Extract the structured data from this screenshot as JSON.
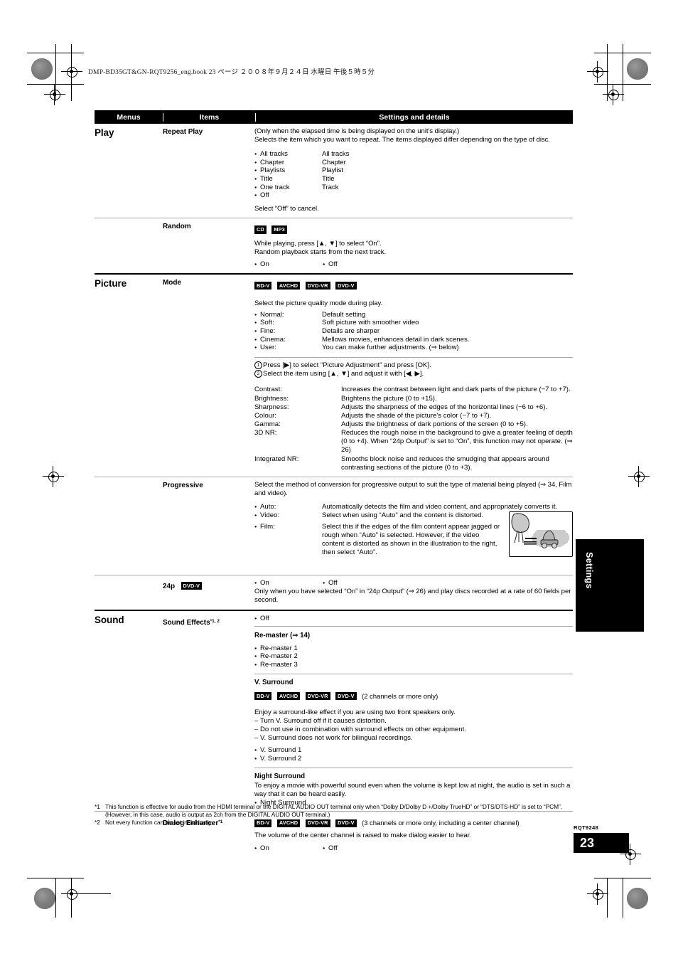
{
  "page": {
    "header_line": "DMP-BD35GT&GN-RQT9256_eng.book   23 ページ   ２００８年９月２４日   水曜日   午後５時５分",
    "side_tab": "Settings",
    "doc_code": "RQT9248",
    "page_number": "23"
  },
  "table": {
    "headers": {
      "menus": "Menus",
      "items": "Items",
      "settings": "Settings and details"
    },
    "sections": [
      {
        "menu": "Play",
        "rows": [
          {
            "item": "Repeat Play",
            "note1": "(Only when the elapsed time is being displayed on the unit's display.)",
            "note2": "Selects the item which you want to repeat. The items displayed differ depending on the type of disc.",
            "options": [
              {
                "left": "All tracks",
                "right": "All tracks"
              },
              {
                "left": "Chapter",
                "right": "Chapter"
              },
              {
                "left": "Playlists",
                "right": "Playlist"
              },
              {
                "left": "Title",
                "right": "Title"
              },
              {
                "left": "One track",
                "right": "Track"
              },
              {
                "left": "Off",
                "right": ""
              }
            ],
            "cancel": "Select “Off” to cancel."
          },
          {
            "item": "Random",
            "badges": [
              "CD",
              "MP3"
            ],
            "line1": "While playing, press [▲, ▼] to select “On”.",
            "line2": "Random playback starts from the next track.",
            "opt_on": "On",
            "opt_off": "Off"
          }
        ]
      },
      {
        "menu": "Picture",
        "rows": [
          {
            "item": "Mode",
            "badges": [
              "BD-V",
              "AVCHD",
              "DVD-VR",
              "DVD-V"
            ],
            "intro": "Select the picture quality mode during play.",
            "modes": [
              {
                "label": "Normal:",
                "desc": "Default setting"
              },
              {
                "label": "Soft:",
                "desc": "Soft picture with smoother video"
              },
              {
                "label": "Fine:",
                "desc": "Details are sharper"
              },
              {
                "label": "Cinema:",
                "desc": "Mellows movies, enhances detail in dark scenes."
              },
              {
                "label": "User:",
                "desc": "You can make further adjustments. (⇒ below)"
              }
            ],
            "step1": "Press [▶] to select “Picture Adjustment” and press [OK].",
            "step2": "Select the item using [▲, ▼] and adjust it with [◀, ▶].",
            "adjustments": [
              {
                "label": "Contrast:",
                "desc": "Increases the contrast between light and dark parts of the picture (−7 to +7)."
              },
              {
                "label": "Brightness:",
                "desc": "Brightens the picture (0 to +15)."
              },
              {
                "label": "Sharpness:",
                "desc": "Adjusts the sharpness of the edges of the horizontal lines (−6 to +6)."
              },
              {
                "label": "Colour:",
                "desc": "Adjusts the shade of the picture's color (−7 to +7)."
              },
              {
                "label": "Gamma:",
                "desc": "Adjusts the brightness of dark portions of the screen (0 to +5)."
              },
              {
                "label": "3D NR:",
                "desc": "Reduces the rough noise in the background to give a greater feeling of depth (0 to +4). When “24p Output” is set to “On”, this function may not operate. (⇒ 26)"
              },
              {
                "label": "Integrated NR:",
                "desc": "Smooths block noise and reduces the smudging that appears around contrasting sections of the picture (0 to +3)."
              }
            ]
          },
          {
            "item": "Progressive",
            "intro": "Select the method of conversion for progressive output to suit the type of material being played (⇒ 34, Film and video).",
            "modes": [
              {
                "label": "Auto:",
                "desc": "Automatically detects the film and video content, and appropriately converts it."
              },
              {
                "label": "Video:",
                "desc": "Select when using “Auto” and the content is distorted."
              },
              {
                "label": "Film:",
                "desc": "Select this if the edges of the film content appear jagged or rough when “Auto” is selected. However, if the video content is distorted as shown in the illustration to the right, then select “Auto”."
              }
            ],
            "illustration": "distorted-video-illustration"
          },
          {
            "item": "24p",
            "badges": [
              "DVD-V"
            ],
            "opt_on": "On",
            "opt_off": "Off",
            "note": "Only when you have selected “On” in “24p Output” (⇒ 26) and play discs recorded at a rate of 60 fields per second."
          }
        ]
      },
      {
        "menu": "Sound",
        "rows": [
          {
            "item": "Sound Effects",
            "item_sup": "*1, 2",
            "opt_off": "Off",
            "groups": [
              {
                "title": "Re-master (⇒ 14)",
                "options": [
                  "Re-master 1",
                  "Re-master 2",
                  "Re-master 3"
                ]
              },
              {
                "title": "V. Surround",
                "badges": [
                  "BD-V",
                  "AVCHD",
                  "DVD-VR",
                  "DVD-V"
                ],
                "badge_note": "(2 channels or more only)",
                "intro": "Enjoy a surround-like effect if you are using two front speakers only.",
                "dashes": [
                  "Turn V. Surround off if it causes distortion.",
                  "Do not use in combination with surround effects on other equipment.",
                  "V. Surround does not work for bilingual recordings."
                ],
                "options": [
                  "V. Surround 1",
                  "V. Surround 2"
                ]
              },
              {
                "title": "Night Surround",
                "intro": "To enjoy a movie with powerful sound even when the volume is kept low at night, the audio is set in such a way that it can be heard easily.",
                "options": [
                  "Night Surround"
                ]
              }
            ]
          },
          {
            "item": "Dialog Enhancer",
            "item_sup": "*1",
            "badges": [
              "BD-V",
              "AVCHD",
              "DVD-VR",
              "DVD-V"
            ],
            "badge_note": "(3 channels or more only, including a center channel)",
            "note": "The volume of the center channel is raised to make dialog easier to hear.",
            "opt_on": "On",
            "opt_off": "Off"
          }
        ]
      }
    ]
  },
  "footnotes": [
    {
      "mark": "*1",
      "text": "This function is effective for audio from the HDMI terminal or the DIGITAL AUDIO OUT terminal only when “Dolby D/Dolby D +/Dolby TrueHD” or “DTS/DTS-HD” is set to “PCM”. (However, in this case, audio is output as 2ch from the DIGITAL AUDIO OUT terminal.)"
    },
    {
      "mark": "*2",
      "text": "Not every function can be set individually."
    }
  ]
}
